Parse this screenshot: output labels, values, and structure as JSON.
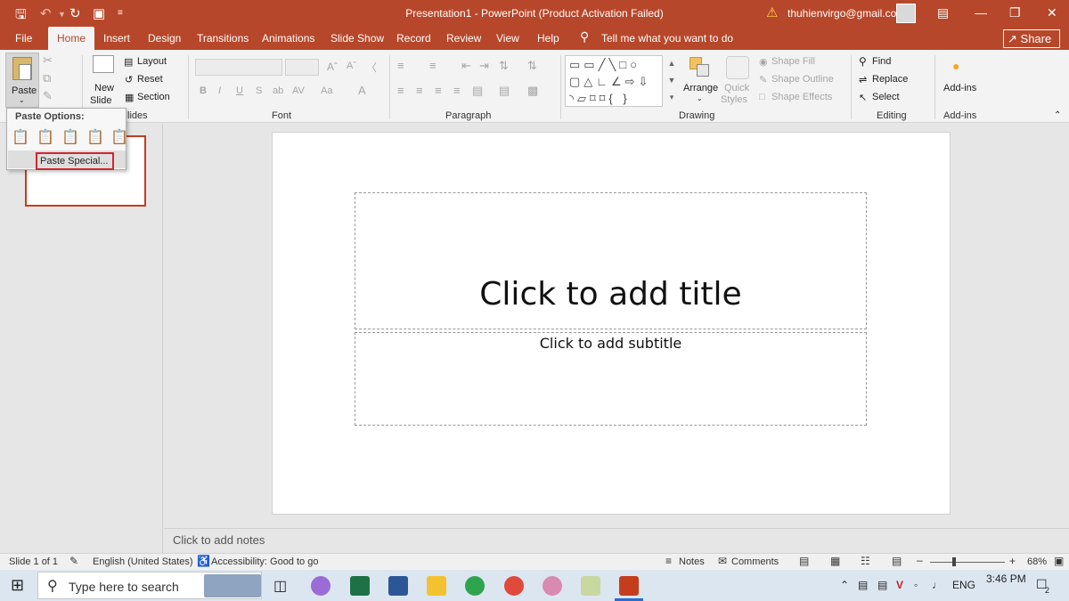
{
  "window": {
    "title": "Presentation1  -  PowerPoint (Product Activation Failed)",
    "account_email": "thuhienvirgo@gmail.com"
  },
  "tabs": [
    "File",
    "Home",
    "Insert",
    "Design",
    "Transitions",
    "Animations",
    "Slide Show",
    "Record",
    "Review",
    "View",
    "Help"
  ],
  "active_tab": "Home",
  "tell_me": "Tell me what you want to do",
  "share_label": "Share",
  "ribbon": {
    "clipboard": {
      "paste": "Paste"
    },
    "slides": {
      "new_slide_1": "New",
      "new_slide_2": "Slide",
      "layout": "Layout",
      "reset": "Reset",
      "section": "Section",
      "group_label": "lides"
    },
    "font": {
      "group_label": "Font"
    },
    "paragraph": {
      "group_label": "Paragraph"
    },
    "drawing": {
      "arrange": "Arrange",
      "quick_styles_1": "Quick",
      "quick_styles_2": "Styles",
      "shape_fill": "Shape Fill",
      "shape_outline": "Shape Outline",
      "shape_effects": "Shape Effects",
      "group_label": "Drawing"
    },
    "editing": {
      "find": "Find",
      "replace": "Replace",
      "select": "Select",
      "group_label": "Editing"
    },
    "addins": {
      "label": "Add-ins",
      "group_label": "Add-ins"
    }
  },
  "paste_menu": {
    "header": "Paste Options:",
    "paste_special": "Paste Special..."
  },
  "slide": {
    "title_placeholder": "Click to add title",
    "subtitle_placeholder": "Click to add subtitle"
  },
  "notes_placeholder": "Click to add notes",
  "status": {
    "slide_info": "Slide 1 of 1",
    "language": "English (United States)",
    "accessibility": "Accessibility: Good to go",
    "notes": "Notes",
    "comments": "Comments",
    "zoom": "68%"
  },
  "taskbar": {
    "search_placeholder": "Type here to search",
    "language": "ENG",
    "time": "3:46 PM",
    "notification_count": "2"
  },
  "colors": {
    "accent": "#b7472a",
    "highlight_border": "#d12630"
  }
}
